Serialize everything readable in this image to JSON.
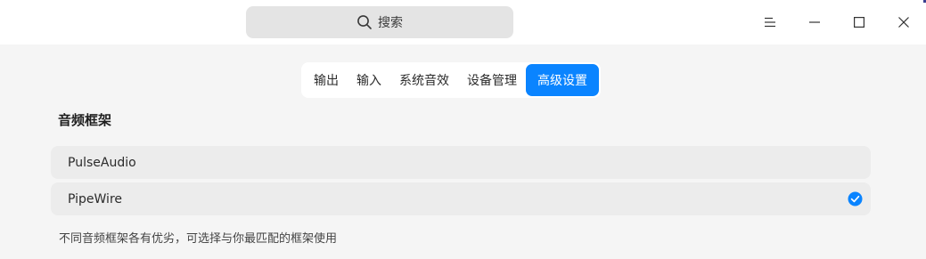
{
  "titlebar": {
    "search": {
      "placeholder": "搜索",
      "icon": "search-icon"
    },
    "window_controls": [
      {
        "name": "menu",
        "icon": "menu-icon"
      },
      {
        "name": "minimize",
        "icon": "minimize-icon"
      },
      {
        "name": "maximize",
        "icon": "maximize-icon"
      },
      {
        "name": "close",
        "icon": "close-icon"
      }
    ]
  },
  "tabs": [
    {
      "label": "输出",
      "active": false
    },
    {
      "label": "输入",
      "active": false
    },
    {
      "label": "系统音效",
      "active": false
    },
    {
      "label": "设备管理",
      "active": false
    },
    {
      "label": "高级设置",
      "active": true
    }
  ],
  "section": {
    "title": "音频框架",
    "options": [
      {
        "label": "PulseAudio",
        "selected": false
      },
      {
        "label": "PipeWire",
        "selected": true
      }
    ],
    "hint": "不同音频框架各有优劣，可选择与你最匹配的框架使用"
  },
  "colors": {
    "accent": "#0a84ff",
    "background": "#f5f5f5",
    "titlebar": "#ffffff",
    "option_bg": "#ececec"
  }
}
